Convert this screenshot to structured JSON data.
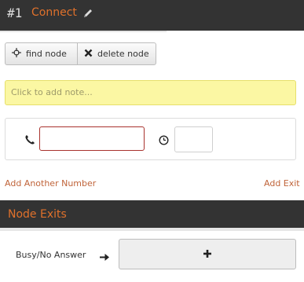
{
  "header": {
    "number": "#1",
    "title": "Connect",
    "edit_icon": "pencil-icon"
  },
  "toolbar": {
    "find_label": "find node",
    "find_icon": "crosshair-icon",
    "delete_label": "delete node",
    "delete_icon": "x-icon"
  },
  "note": {
    "placeholder": "Click to add note..."
  },
  "dial": {
    "phone_icon": "phone-icon",
    "phone_value": "",
    "timeout_icon": "clock-icon",
    "timeout_value": ""
  },
  "actions": {
    "add_number": "Add Another Number",
    "add_exit": "Add Exit"
  },
  "exits": {
    "title": "Node Exits",
    "items": [
      {
        "label": "Busy/No Answer",
        "arrow_icon": "arrow-right-icon",
        "target_icon": "plus-icon"
      }
    ]
  },
  "colors": {
    "header_bg": "#333333",
    "accent": "#e0712b",
    "link": "#c0643a",
    "note_bg": "#fbf7a3",
    "invalid_border": "#a8322d"
  }
}
